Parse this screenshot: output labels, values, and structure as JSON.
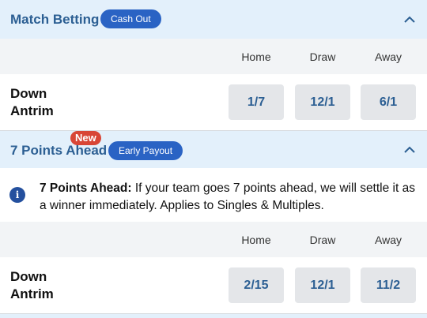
{
  "match_betting": {
    "title": "Match Betting",
    "badge": "Cash Out",
    "chevron_icon": "chevron-up-icon",
    "columns": [
      "Home",
      "Draw",
      "Away"
    ],
    "row": {
      "team_line1": "Down",
      "team_line2": "Antrim",
      "odds": [
        "1/7",
        "12/1",
        "6/1"
      ]
    }
  },
  "seven_points": {
    "title": "7 Points Ahead",
    "new_badge": "New",
    "badge": "Early Payout",
    "chevron_icon": "chevron-up-icon",
    "info_icon": "info-icon",
    "info_icon_glyph": "i",
    "info_bold": "7 Points Ahead:",
    "info_text": " If your team goes 7 points ahead, we will settle it as a winner immediately. Applies to Singles & Multiples.",
    "columns": [
      "Home",
      "Draw",
      "Away"
    ],
    "row": {
      "team_line1": "Down",
      "team_line2": "Antrim",
      "odds": [
        "2/15",
        "12/1",
        "11/2"
      ]
    }
  },
  "colors": {
    "accent": "#2a63c4",
    "title": "#2c5f93",
    "header_bg": "#e3f0fb",
    "new_badge": "#d84636",
    "odds_bg": "#e4e6e9"
  }
}
